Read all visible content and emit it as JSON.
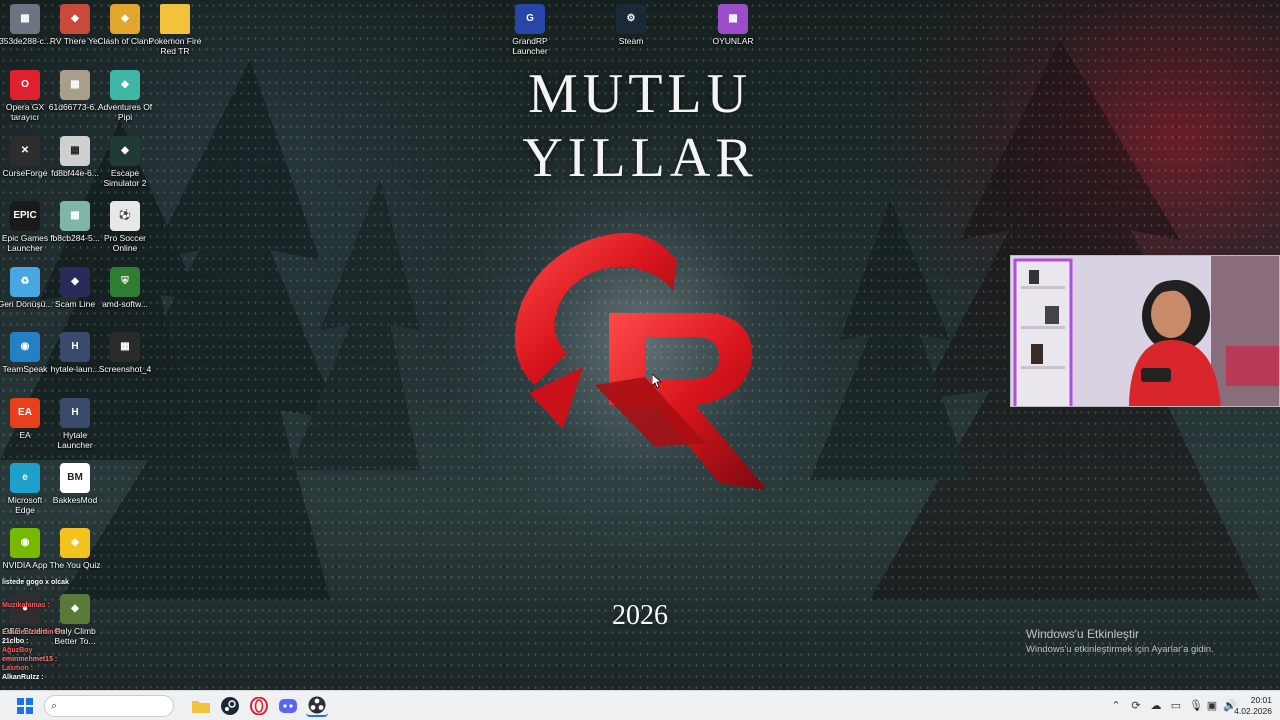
{
  "wallpaper": {
    "headline": "MUTLU YILLAR",
    "year": "2026",
    "accent_color": "#d8141c"
  },
  "desktop_icons": [
    {
      "label": "353de288-c...",
      "icon": "image-file-icon",
      "color": "#6b7480"
    },
    {
      "label": "RV There Yet",
      "icon": "game-icon",
      "color": "#c94a3b"
    },
    {
      "label": "Clash of Clans",
      "icon": "game-icon",
      "color": "#e0a72c"
    },
    {
      "label": "Pokemon Fire Red TR",
      "icon": "folder-icon",
      "color": "#f2c23a"
    },
    {
      "label": "Opera GX tarayıcı",
      "icon": "opera-gx-icon",
      "color": "#e0202f"
    },
    {
      "label": "61d66773-6...",
      "icon": "image-file-icon",
      "color": "#a99d8c"
    },
    {
      "label": "Adventures Of Pipi",
      "icon": "game-icon",
      "color": "#3fb7a6"
    },
    {
      "label": "CurseForge",
      "icon": "curseforge-icon",
      "color": "#2d2d2d"
    },
    {
      "label": "fd8bf44e-6...",
      "icon": "image-file-icon",
      "color": "#cfcfcf"
    },
    {
      "label": "Escape Simulator 2",
      "icon": "game-icon",
      "color": "#1f3b35"
    },
    {
      "label": "Epic Games Launcher",
      "icon": "epic-games-icon",
      "color": "#1a1a1a"
    },
    {
      "label": "fb8cb284-5...",
      "icon": "image-file-icon",
      "color": "#7fb7a7"
    },
    {
      "label": "Pro Soccer Online",
      "icon": "soccer-ball-icon",
      "color": "#e8e8e8"
    },
    {
      "label": "Geri Dönüşü...",
      "icon": "recycle-bin-icon",
      "color": "#48a7e0"
    },
    {
      "label": "Scam Line",
      "icon": "game-icon",
      "color": "#2a2a5a"
    },
    {
      "label": "amd-softw...",
      "icon": "shield-icon",
      "color": "#2e7d32"
    },
    {
      "label": "TeamSpeak",
      "icon": "teamspeak-icon",
      "color": "#2580c3"
    },
    {
      "label": "hytale-laun...",
      "icon": "hytale-icon",
      "color": "#3a4a6b"
    },
    {
      "label": "Screenshot_4",
      "icon": "image-file-icon",
      "color": "#2b2b2b"
    },
    {
      "label": "EA",
      "icon": "ea-icon",
      "color": "#e8401c"
    },
    {
      "label": "Hytale Launcher",
      "icon": "hytale-icon",
      "color": "#3a4a6b"
    },
    {
      "label": "Microsoft Edge",
      "icon": "edge-icon",
      "color": "#1da0c9"
    },
    {
      "label": "BakkesMod",
      "icon": "bakkesmod-icon",
      "color": "#ffffff"
    },
    {
      "label": "NVIDIA App",
      "icon": "nvidia-icon",
      "color": "#76b900"
    },
    {
      "label": "The You Quiz",
      "icon": "game-icon",
      "color": "#f4c21c"
    },
    {
      "label": "OBS Studio",
      "icon": "obs-icon",
      "color": "#302e31"
    },
    {
      "label": "Only Climb Better To...",
      "icon": "game-icon",
      "color": "#5b7a3a"
    },
    {
      "label": "GrandRP Launcher",
      "icon": "grandrp-icon",
      "color": "#2846a8"
    },
    {
      "label": "Steam",
      "icon": "steam-icon",
      "color": "#1b2838"
    },
    {
      "label": "OYUNLAR",
      "icon": "games-folder-icon",
      "color": "#9b4dca"
    }
  ],
  "chat_overlay": {
    "lines": [
      "listede gogo x olcak",
      "Muzikafamas :",
      "Eskidenizlerdin Bu",
      "21clbo :",
      "AğuzBoy",
      "eminmehmet15 :",
      "Lasmon :",
      "AlkanRuIzz :"
    ]
  },
  "activation": {
    "title": "Windows'u Etkinleştir",
    "subtitle": "Windows'u etkinleştirmek için Ayarlar'a gidin."
  },
  "taskbar": {
    "apps": [
      {
        "name": "search",
        "icon": "search-icon",
        "color": "#444"
      },
      {
        "name": "file-explorer",
        "icon": "folder-icon",
        "color": "#f2c23a"
      },
      {
        "name": "steam",
        "icon": "steam-icon",
        "color": "#1b2838"
      },
      {
        "name": "opera-gx",
        "icon": "opera-gx-icon",
        "color": "#e0202f"
      },
      {
        "name": "discord",
        "icon": "discord-icon",
        "color": "#5865f2"
      },
      {
        "name": "obs",
        "icon": "obs-icon",
        "color": "#302e31"
      }
    ],
    "clock": {
      "time": "20:01",
      "date": "4.02.2026"
    }
  }
}
